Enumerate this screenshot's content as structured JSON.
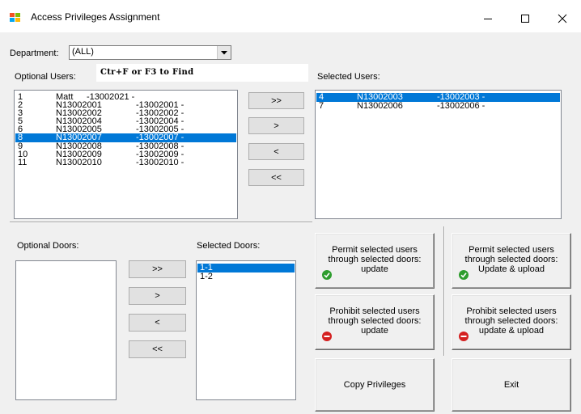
{
  "window": {
    "title": "Access Privileges Assignment"
  },
  "department": {
    "label": "Department:",
    "value": "(ALL)"
  },
  "optional_users": {
    "label": "Optional Users:",
    "hint": "Ctr+F  or F3 to Find",
    "rows": [
      {
        "id": "1",
        "name": "Matt",
        "code": "-13002021 -"
      },
      {
        "id": "2",
        "name": "N13002001",
        "code": "-13002001 -"
      },
      {
        "id": "3",
        "name": "N13002002",
        "code": "-13002002 -"
      },
      {
        "id": "5",
        "name": "N13002004",
        "code": "-13002004 -"
      },
      {
        "id": "6",
        "name": "N13002005",
        "code": "-13002005 -"
      },
      {
        "id": "8",
        "name": "N13002007",
        "code": "-13002007 -"
      },
      {
        "id": "9",
        "name": "N13002008",
        "code": "-13002008 -"
      },
      {
        "id": "10",
        "name": "N13002009",
        "code": "-13002009 -"
      },
      {
        "id": "11",
        "name": "N13002010",
        "code": "-13002010 -"
      }
    ]
  },
  "selected_users": {
    "label": "Selected Users:",
    "rows": [
      {
        "id": "4",
        "name": "N13002003",
        "code": "-13002003 -"
      },
      {
        "id": "7",
        "name": "N13002006",
        "code": "-13002006 -"
      }
    ]
  },
  "user_transfer": {
    "add_all": ">>",
    "add": ">",
    "remove": "<",
    "remove_all": "<<"
  },
  "optional_doors": {
    "label": "Optional Doors:"
  },
  "selected_doors": {
    "label": "Selected Doors:",
    "items": [
      "1-1",
      "1-2"
    ]
  },
  "door_transfer": {
    "add_all": ">>",
    "add": ">",
    "remove": "<",
    "remove_all": "<<"
  },
  "actions": {
    "permit_update": "Permit selected users through selected doors: update",
    "permit_upload": "Permit selected users through selected doors: Update & upload",
    "prohibit_update": "Prohibit selected users through selected doors: update",
    "prohibit_upload": "Prohibit selected users through selected doors: update & upload",
    "copy": "Copy Privileges",
    "exit": "Exit"
  },
  "colors": {
    "selection": "#0078d7",
    "permit_icon": "#2e9d2e",
    "prohibit_icon": "#d42020"
  }
}
